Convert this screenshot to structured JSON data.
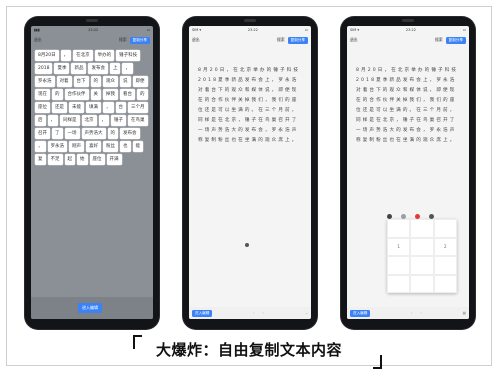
{
  "caption": "大爆炸：自由复制文本内容",
  "phone1": {
    "status_time": "23:22",
    "back_label": "退出",
    "search_label": "搜索",
    "copy_label": "复制分享",
    "tokens": [
      "8月20日",
      "，",
      "在北京",
      "举办的",
      "锤子科技",
      "2018",
      "夏季",
      "新品",
      "发布会",
      "上",
      "，",
      "罗永浩",
      "对着",
      "台下",
      "的",
      "观众",
      "说",
      "即便",
      "现在",
      "的",
      "合作伙伴",
      "关",
      "掉我",
      "看台",
      "的",
      "座位",
      "还是",
      "未能",
      "填满",
      "，",
      "台",
      "三个月",
      "后",
      "，",
      "同样是",
      "北京",
      "，",
      "锤子",
      "在鸟巢",
      "召开",
      "了",
      "一场",
      "声势浩大",
      "的",
      "发布会",
      "，",
      "罗永浩",
      "刚声",
      "喜好",
      "粉丝",
      "也",
      "能",
      "复",
      "不足",
      "起",
      "始",
      "座位",
      "开满"
    ],
    "enter_label": "进入编辑"
  },
  "phone2": {
    "status_time": "23:22",
    "back_label": "退出",
    "search_label": "搜索",
    "copy_label": "复制分享",
    "paragraph": "8月20日，在北京举办的锤子科技2018夏季新品发布会上，罗永浩对着台下的观众和媒体说，即便现在的合作伙伴关掉我们，我们的座位还是可以坐满的。在三个月前，同样是在北京，锤子在鸟巢召开了一场声势浩大的发布会，罗永浩声称复制粉丝也在坐满的观众席上。",
    "bottom_left": "进入编辑",
    "bottom_right": "..."
  },
  "phone3": {
    "status_time": "23:22",
    "back_label": "退出",
    "search_label": "搜索",
    "copy_label": "复制分享",
    "paragraph": "8月20日，在北京举办的锤子科技2018夏季新品发布会上，罗永浩对着台下的观众和媒体说，即便现在的合作伙伴关掉我们，我们的座位还是可以坐满的。在三个月前，同样是在北京，锤子在鸟巢召开了一场声势浩大的发布会，罗永浩声称复制粉丝也在坐满的观众席上。",
    "keypad": [
      "",
      "",
      "",
      "1",
      "",
      "2",
      "",
      "",
      "",
      "",
      "",
      "",
      ""
    ],
    "dot_colors": [
      "#444444",
      "#9aa0aa",
      "#e53935",
      "#555555"
    ],
    "bottom_left": "进入编辑",
    "bottom_right": "..."
  }
}
